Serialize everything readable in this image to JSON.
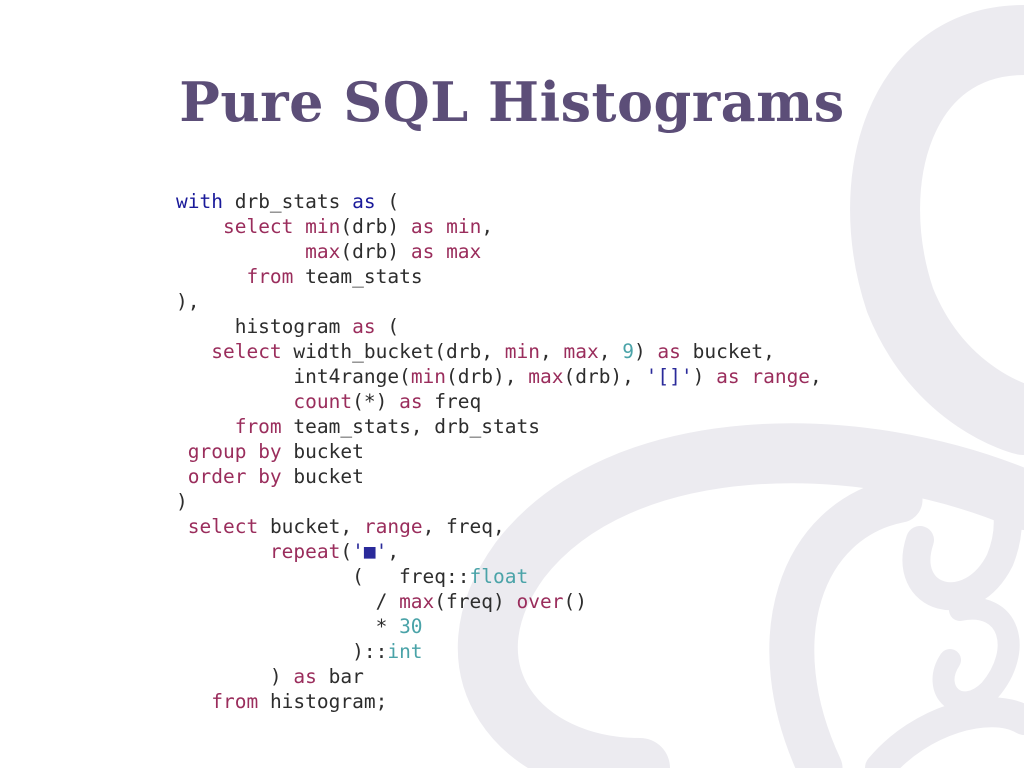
{
  "slide": {
    "title": "Pure SQL Histograms"
  },
  "colors": {
    "title": "#5c4e78",
    "keyword": "#9a2d5c",
    "keyword_with": "#1a1a9a",
    "number": "#4aa3a8",
    "plain": "#2d2d2d",
    "background_decor": "#ecebf0"
  },
  "code": {
    "language": "sql",
    "lines": [
      [
        {
          "t": "with",
          "c": "kw-blue"
        },
        {
          "t": " drb_stats ",
          "c": "plain"
        },
        {
          "t": "as",
          "c": "kw-blue"
        },
        {
          "t": " (",
          "c": "plain"
        }
      ],
      [
        {
          "t": "    ",
          "c": "plain"
        },
        {
          "t": "select",
          "c": "kw"
        },
        {
          "t": " ",
          "c": "plain"
        },
        {
          "t": "min",
          "c": "kw"
        },
        {
          "t": "(drb) ",
          "c": "plain"
        },
        {
          "t": "as",
          "c": "kw"
        },
        {
          "t": " ",
          "c": "plain"
        },
        {
          "t": "min",
          "c": "kw"
        },
        {
          "t": ",",
          "c": "plain"
        }
      ],
      [
        {
          "t": "           ",
          "c": "plain"
        },
        {
          "t": "max",
          "c": "kw"
        },
        {
          "t": "(drb) ",
          "c": "plain"
        },
        {
          "t": "as",
          "c": "kw"
        },
        {
          "t": " ",
          "c": "plain"
        },
        {
          "t": "max",
          "c": "kw"
        }
      ],
      [
        {
          "t": "      ",
          "c": "plain"
        },
        {
          "t": "from",
          "c": "kw"
        },
        {
          "t": " team_stats",
          "c": "plain"
        }
      ],
      [
        {
          "t": "),",
          "c": "plain"
        }
      ],
      [
        {
          "t": "     histogram ",
          "c": "plain"
        },
        {
          "t": "as",
          "c": "kw"
        },
        {
          "t": " (",
          "c": "plain"
        }
      ],
      [
        {
          "t": "   ",
          "c": "plain"
        },
        {
          "t": "select",
          "c": "kw"
        },
        {
          "t": " width_bucket(drb, ",
          "c": "plain"
        },
        {
          "t": "min",
          "c": "kw"
        },
        {
          "t": ", ",
          "c": "plain"
        },
        {
          "t": "max",
          "c": "kw"
        },
        {
          "t": ", ",
          "c": "plain"
        },
        {
          "t": "9",
          "c": "num"
        },
        {
          "t": ") ",
          "c": "plain"
        },
        {
          "t": "as",
          "c": "kw"
        },
        {
          "t": " bucket,",
          "c": "plain"
        }
      ],
      [
        {
          "t": "          int4range(",
          "c": "plain"
        },
        {
          "t": "min",
          "c": "kw"
        },
        {
          "t": "(drb), ",
          "c": "plain"
        },
        {
          "t": "max",
          "c": "kw"
        },
        {
          "t": "(drb), ",
          "c": "plain"
        },
        {
          "t": "'[]'",
          "c": "str"
        },
        {
          "t": ") ",
          "c": "plain"
        },
        {
          "t": "as",
          "c": "kw"
        },
        {
          "t": " ",
          "c": "plain"
        },
        {
          "t": "range",
          "c": "kw"
        },
        {
          "t": ",",
          "c": "plain"
        }
      ],
      [
        {
          "t": "          ",
          "c": "plain"
        },
        {
          "t": "count",
          "c": "kw"
        },
        {
          "t": "(*) ",
          "c": "plain"
        },
        {
          "t": "as",
          "c": "kw"
        },
        {
          "t": " freq",
          "c": "plain"
        }
      ],
      [
        {
          "t": "     ",
          "c": "plain"
        },
        {
          "t": "from",
          "c": "kw"
        },
        {
          "t": " team_stats, drb_stats",
          "c": "plain"
        }
      ],
      [
        {
          "t": " ",
          "c": "plain"
        },
        {
          "t": "group by",
          "c": "kw"
        },
        {
          "t": " bucket",
          "c": "plain"
        }
      ],
      [
        {
          "t": " ",
          "c": "plain"
        },
        {
          "t": "order by",
          "c": "kw"
        },
        {
          "t": " bucket",
          "c": "plain"
        }
      ],
      [
        {
          "t": ")",
          "c": "plain"
        }
      ],
      [
        {
          "t": " ",
          "c": "plain"
        },
        {
          "t": "select",
          "c": "kw"
        },
        {
          "t": " bucket, ",
          "c": "plain"
        },
        {
          "t": "range",
          "c": "kw"
        },
        {
          "t": ", freq,",
          "c": "plain"
        }
      ],
      [
        {
          "t": "        ",
          "c": "plain"
        },
        {
          "t": "repeat",
          "c": "kw"
        },
        {
          "t": "(",
          "c": "plain"
        },
        {
          "t": "'■'",
          "c": "str"
        },
        {
          "t": ",",
          "c": "plain"
        }
      ],
      [
        {
          "t": "               (   freq::",
          "c": "plain"
        },
        {
          "t": "float",
          "c": "type"
        }
      ],
      [
        {
          "t": "                 / ",
          "c": "plain"
        },
        {
          "t": "max",
          "c": "kw"
        },
        {
          "t": "(freq) ",
          "c": "plain"
        },
        {
          "t": "over",
          "c": "kw"
        },
        {
          "t": "()",
          "c": "plain"
        }
      ],
      [
        {
          "t": "                 * ",
          "c": "plain"
        },
        {
          "t": "30",
          "c": "num"
        }
      ],
      [
        {
          "t": "               )::",
          "c": "plain"
        },
        {
          "t": "int",
          "c": "type"
        }
      ],
      [
        {
          "t": "        ) ",
          "c": "plain"
        },
        {
          "t": "as",
          "c": "kw"
        },
        {
          "t": " bar",
          "c": "plain"
        }
      ],
      [
        {
          "t": "   ",
          "c": "plain"
        },
        {
          "t": "from",
          "c": "kw"
        },
        {
          "t": " histogram;",
          "c": "plain"
        }
      ]
    ]
  }
}
